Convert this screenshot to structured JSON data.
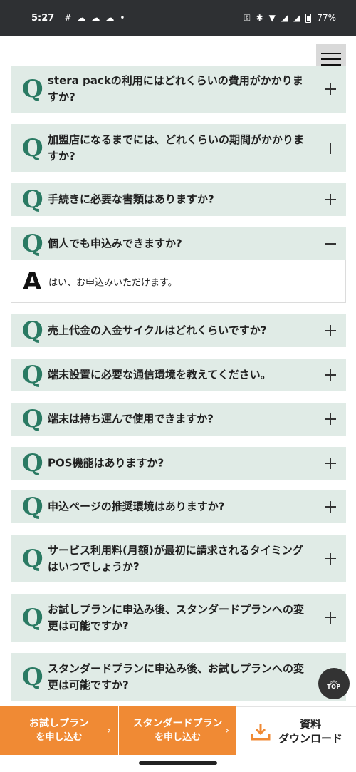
{
  "status": {
    "time": "5:27",
    "notifications": [
      "#",
      "☁",
      "☁",
      "☁",
      "•"
    ],
    "icons": [
      "key-icon",
      "bluetooth-icon",
      "wifi-icon",
      "signal-icon",
      "signal-icon",
      "battery-icon"
    ],
    "battery": "77%"
  },
  "faq": [
    {
      "q": "Q",
      "text": "stera packの利用にはどれくらいの費用がかかりますか?",
      "expanded": false
    },
    {
      "q": "Q",
      "text": "加盟店になるまでには、どれくらいの期間がかかりますか?",
      "expanded": false
    },
    {
      "q": "Q",
      "text": "手続きに必要な書類はありますか?",
      "expanded": false
    },
    {
      "q": "Q",
      "text": "個人でも申込みできますか?",
      "expanded": true,
      "answer_label": "A",
      "answer": "はい、お申込みいただけます。"
    },
    {
      "q": "Q",
      "text": "売上代金の入金サイクルはどれくらいですか?",
      "expanded": false
    },
    {
      "q": "Q",
      "text": "端末設置に必要な通信環境を教えてください。",
      "expanded": false
    },
    {
      "q": "Q",
      "text": "端末は持ち運んで使用できますか?",
      "expanded": false
    },
    {
      "q": "Q",
      "text": "POS機能はありますか?",
      "expanded": false
    },
    {
      "q": "Q",
      "text": "申込ページの推奨環境はありますか?",
      "expanded": false
    },
    {
      "q": "Q",
      "text": "サービス利用料(月額)が最初に請求されるタイミングはいつでしょうか?",
      "expanded": false
    },
    {
      "q": "Q",
      "text": "お試しプランに申込み後、スタンダードプランへの変更は可能ですか?",
      "expanded": false
    },
    {
      "q": "Q",
      "text": "スタンダードプランに申込み後、お試しプランへの変更は可能ですか?",
      "expanded": false
    }
  ],
  "top_button": {
    "chevron": "︽",
    "label": "TOP"
  },
  "cta": {
    "trial": {
      "line1": "お試しプラン",
      "line2": "を申し込む",
      "arrow": "›"
    },
    "standard": {
      "line1": "スタンダードプラン",
      "line2": "を申し込む",
      "arrow": "›"
    },
    "download": {
      "line1": "資料",
      "line2": "ダウンロード",
      "icon": "download-icon"
    }
  },
  "colors": {
    "accent": "#f08a34",
    "q_green": "#2a7a63",
    "faq_bg": "#e0ebe6"
  }
}
